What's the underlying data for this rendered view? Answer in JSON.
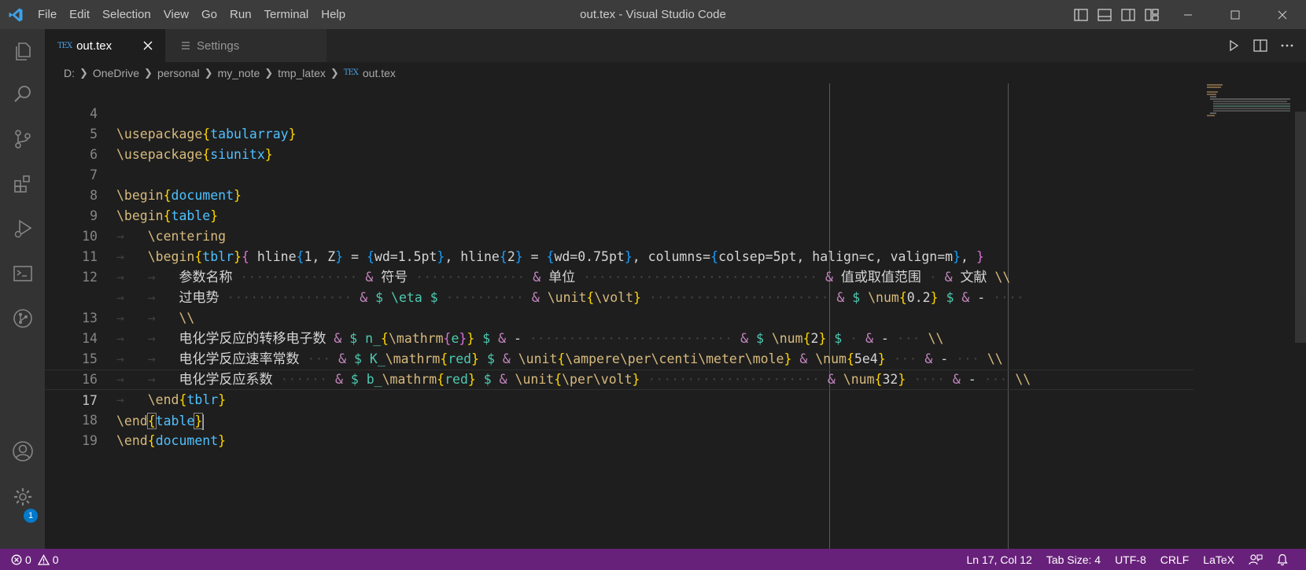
{
  "titlebar": {
    "window_title": "out.tex - Visual Studio Code",
    "menu": [
      "File",
      "Edit",
      "Selection",
      "View",
      "Go",
      "Run",
      "Terminal",
      "Help"
    ]
  },
  "tabs": [
    {
      "label": "out.tex",
      "icon": "tex-icon",
      "active": true
    },
    {
      "label": "Settings",
      "icon": "settings-list-icon",
      "active": false
    }
  ],
  "breadcrumb": [
    "D:",
    "OneDrive",
    "personal",
    "my_note",
    "tmp_latex",
    "out.tex"
  ],
  "editor": {
    "line_numbers": [
      "4",
      "5",
      "6",
      "7",
      "8",
      "9",
      "10",
      "11",
      "12",
      "",
      "13",
      "14",
      "15",
      "16",
      "17",
      "18",
      "19"
    ],
    "current_line": "17",
    "code_lines": [
      "\\usepackage{tabularray}",
      "\\usepackage{siunitx}",
      "",
      "\\begin{document}",
      "\\begin{table}",
      "    \\centering",
      "    \\begin{tblr}{ hline{1, Z} = {wd=1.5pt}, hline{2} = {wd=0.75pt}, columns={colsep=5pt, halign=c, valign=m}, }",
      "        参数名称 & 符号 & 单位 & 值或取值范围 & 文献 \\\\",
      "        过电势 & $ \\eta $ & \\unit{\\volt} & $ \\num{0.2} $ & -",
      "        \\\\",
      "        电化学反应的转移电子数 & $ n_{\\mathrm{e}} $ & - & $ \\num{2} $ & - \\\\",
      "        电化学反应速率常数 & $ K_\\mathrm{red} $ & \\unit{\\ampere\\per\\centi\\meter\\mole} & \\num{5e4} & - \\\\",
      "        电化学反应系数 & $ b_\\mathrm{red} $ & \\unit{\\per\\volt} & \\num{32} & - \\\\",
      "    \\end{tblr}",
      "\\end{table}",
      "\\end{document}",
      ""
    ]
  },
  "statusbar": {
    "errors": "0",
    "warnings": "0",
    "position": "Ln 17, Col 12",
    "tab_size": "Tab Size: 4",
    "encoding": "UTF-8",
    "eol": "CRLF",
    "language": "LaTeX"
  },
  "activity": {
    "accounts_badge": "1"
  },
  "colors": {
    "status_bar": "#68217a",
    "title_bar": "#3c3c3c",
    "activity_bar": "#333333",
    "editor_bg": "#1e1e1e",
    "accent": "#007acc"
  }
}
